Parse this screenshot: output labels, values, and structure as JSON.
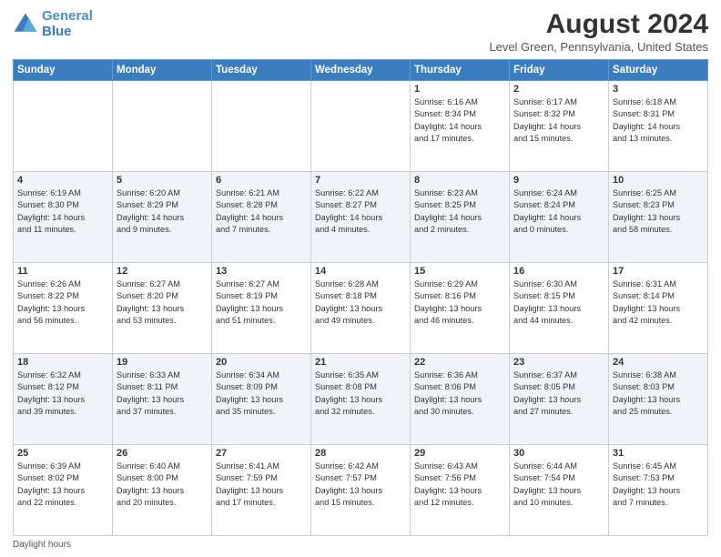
{
  "header": {
    "logo_line1": "General",
    "logo_line2": "Blue",
    "month_year": "August 2024",
    "location": "Level Green, Pennsylvania, United States"
  },
  "days_of_week": [
    "Sunday",
    "Monday",
    "Tuesday",
    "Wednesday",
    "Thursday",
    "Friday",
    "Saturday"
  ],
  "weeks": [
    [
      {
        "day": "",
        "content": ""
      },
      {
        "day": "",
        "content": ""
      },
      {
        "day": "",
        "content": ""
      },
      {
        "day": "",
        "content": ""
      },
      {
        "day": "1",
        "content": "Sunrise: 6:16 AM\nSunset: 8:34 PM\nDaylight: 14 hours\nand 17 minutes."
      },
      {
        "day": "2",
        "content": "Sunrise: 6:17 AM\nSunset: 8:32 PM\nDaylight: 14 hours\nand 15 minutes."
      },
      {
        "day": "3",
        "content": "Sunrise: 6:18 AM\nSunset: 8:31 PM\nDaylight: 14 hours\nand 13 minutes."
      }
    ],
    [
      {
        "day": "4",
        "content": "Sunrise: 6:19 AM\nSunset: 8:30 PM\nDaylight: 14 hours\nand 11 minutes."
      },
      {
        "day": "5",
        "content": "Sunrise: 6:20 AM\nSunset: 8:29 PM\nDaylight: 14 hours\nand 9 minutes."
      },
      {
        "day": "6",
        "content": "Sunrise: 6:21 AM\nSunset: 8:28 PM\nDaylight: 14 hours\nand 7 minutes."
      },
      {
        "day": "7",
        "content": "Sunrise: 6:22 AM\nSunset: 8:27 PM\nDaylight: 14 hours\nand 4 minutes."
      },
      {
        "day": "8",
        "content": "Sunrise: 6:23 AM\nSunset: 8:25 PM\nDaylight: 14 hours\nand 2 minutes."
      },
      {
        "day": "9",
        "content": "Sunrise: 6:24 AM\nSunset: 8:24 PM\nDaylight: 14 hours\nand 0 minutes."
      },
      {
        "day": "10",
        "content": "Sunrise: 6:25 AM\nSunset: 8:23 PM\nDaylight: 13 hours\nand 58 minutes."
      }
    ],
    [
      {
        "day": "11",
        "content": "Sunrise: 6:26 AM\nSunset: 8:22 PM\nDaylight: 13 hours\nand 56 minutes."
      },
      {
        "day": "12",
        "content": "Sunrise: 6:27 AM\nSunset: 8:20 PM\nDaylight: 13 hours\nand 53 minutes."
      },
      {
        "day": "13",
        "content": "Sunrise: 6:27 AM\nSunset: 8:19 PM\nDaylight: 13 hours\nand 51 minutes."
      },
      {
        "day": "14",
        "content": "Sunrise: 6:28 AM\nSunset: 8:18 PM\nDaylight: 13 hours\nand 49 minutes."
      },
      {
        "day": "15",
        "content": "Sunrise: 6:29 AM\nSunset: 8:16 PM\nDaylight: 13 hours\nand 46 minutes."
      },
      {
        "day": "16",
        "content": "Sunrise: 6:30 AM\nSunset: 8:15 PM\nDaylight: 13 hours\nand 44 minutes."
      },
      {
        "day": "17",
        "content": "Sunrise: 6:31 AM\nSunset: 8:14 PM\nDaylight: 13 hours\nand 42 minutes."
      }
    ],
    [
      {
        "day": "18",
        "content": "Sunrise: 6:32 AM\nSunset: 8:12 PM\nDaylight: 13 hours\nand 39 minutes."
      },
      {
        "day": "19",
        "content": "Sunrise: 6:33 AM\nSunset: 8:11 PM\nDaylight: 13 hours\nand 37 minutes."
      },
      {
        "day": "20",
        "content": "Sunrise: 6:34 AM\nSunset: 8:09 PM\nDaylight: 13 hours\nand 35 minutes."
      },
      {
        "day": "21",
        "content": "Sunrise: 6:35 AM\nSunset: 8:08 PM\nDaylight: 13 hours\nand 32 minutes."
      },
      {
        "day": "22",
        "content": "Sunrise: 6:36 AM\nSunset: 8:06 PM\nDaylight: 13 hours\nand 30 minutes."
      },
      {
        "day": "23",
        "content": "Sunrise: 6:37 AM\nSunset: 8:05 PM\nDaylight: 13 hours\nand 27 minutes."
      },
      {
        "day": "24",
        "content": "Sunrise: 6:38 AM\nSunset: 8:03 PM\nDaylight: 13 hours\nand 25 minutes."
      }
    ],
    [
      {
        "day": "25",
        "content": "Sunrise: 6:39 AM\nSunset: 8:02 PM\nDaylight: 13 hours\nand 22 minutes."
      },
      {
        "day": "26",
        "content": "Sunrise: 6:40 AM\nSunset: 8:00 PM\nDaylight: 13 hours\nand 20 minutes."
      },
      {
        "day": "27",
        "content": "Sunrise: 6:41 AM\nSunset: 7:59 PM\nDaylight: 13 hours\nand 17 minutes."
      },
      {
        "day": "28",
        "content": "Sunrise: 6:42 AM\nSunset: 7:57 PM\nDaylight: 13 hours\nand 15 minutes."
      },
      {
        "day": "29",
        "content": "Sunrise: 6:43 AM\nSunset: 7:56 PM\nDaylight: 13 hours\nand 12 minutes."
      },
      {
        "day": "30",
        "content": "Sunrise: 6:44 AM\nSunset: 7:54 PM\nDaylight: 13 hours\nand 10 minutes."
      },
      {
        "day": "31",
        "content": "Sunrise: 6:45 AM\nSunset: 7:53 PM\nDaylight: 13 hours\nand 7 minutes."
      }
    ]
  ],
  "footer": {
    "daylight_label": "Daylight hours"
  }
}
